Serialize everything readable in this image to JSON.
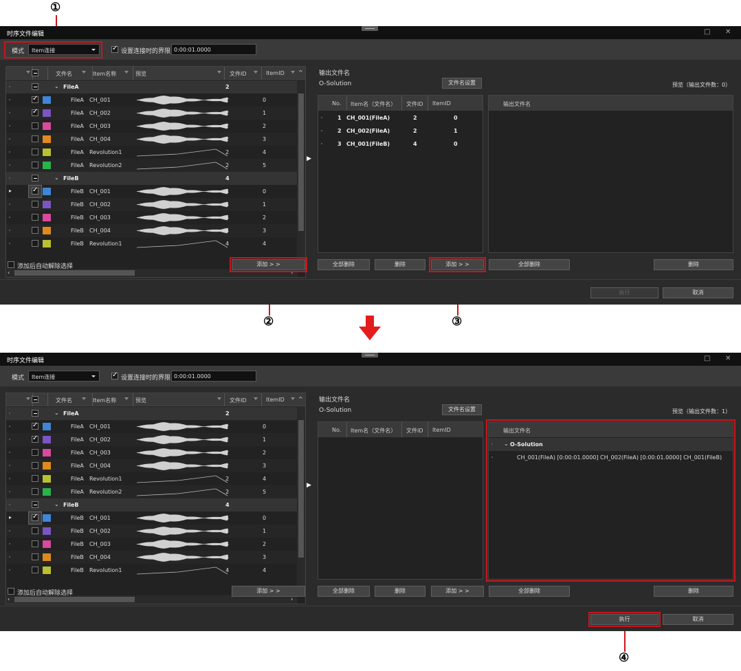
{
  "callouts": [
    "①",
    "②",
    "③",
    "④"
  ],
  "windows": [
    {
      "title": "时序文件编辑",
      "mode_label": "模式",
      "mode_value": "Item连接",
      "boundary_checked": true,
      "boundary_label": "设置连接时的界限",
      "boundary_time": "0:00:01.0000",
      "columns": {
        "filename": "文件名",
        "item_name": "Item名称",
        "preview": "预览",
        "file_id": "文件ID",
        "item_id": "ItemID"
      },
      "groups": [
        {
          "label": "FileA",
          "file_id": "2",
          "rows": [
            {
              "file": "FileA",
              "item": "CH_001",
              "fid": "2",
              "iid": "0",
              "checked": true,
              "color": "#3f86d6",
              "wave": "audio"
            },
            {
              "file": "FileA",
              "item": "CH_002",
              "fid": "2",
              "iid": "1",
              "checked": true,
              "color": "#7b55c4",
              "wave": "audio"
            },
            {
              "file": "FileA",
              "item": "CH_003",
              "fid": "2",
              "iid": "2",
              "checked": false,
              "color": "#d94a9f",
              "wave": "audio"
            },
            {
              "file": "FileA",
              "item": "CH_004",
              "fid": "2",
              "iid": "3",
              "checked": false,
              "color": "#e08a1e",
              "wave": "audio"
            },
            {
              "file": "FileA",
              "item": "Revolution1",
              "fid": "2",
              "iid": "4",
              "checked": false,
              "color": "#b9c131",
              "wave": "line"
            },
            {
              "file": "FileA",
              "item": "Revolution2",
              "fid": "2",
              "iid": "5",
              "checked": false,
              "color": "#2bb24c",
              "wave": "line"
            }
          ]
        },
        {
          "label": "FileB",
          "file_id": "4",
          "rows": [
            {
              "file": "FileB",
              "item": "CH_001",
              "fid": "4",
              "iid": "0",
              "checked": true,
              "color": "#3f86d6",
              "wave": "audio"
            },
            {
              "file": "FileB",
              "item": "CH_002",
              "fid": "4",
              "iid": "1",
              "checked": false,
              "color": "#7b55c4",
              "wave": "audio"
            },
            {
              "file": "FileB",
              "item": "CH_003",
              "fid": "4",
              "iid": "2",
              "checked": false,
              "color": "#d94a9f",
              "wave": "audio"
            },
            {
              "file": "FileB",
              "item": "CH_004",
              "fid": "4",
              "iid": "3",
              "checked": false,
              "color": "#e08a1e",
              "wave": "audio"
            },
            {
              "file": "FileB",
              "item": "Revolution1",
              "fid": "4",
              "iid": "4",
              "checked": false,
              "color": "#b9c131",
              "wave": "line"
            }
          ]
        }
      ],
      "auto_deselect_label": "添加后自动解除选择",
      "add_button": "添加 > >",
      "output_name_label": "输出文件名",
      "output_name": "O-Solution",
      "filename_settings": "文件名设置",
      "preview_count": "预览（输出文件数：0）",
      "mid_columns": {
        "no": "No.",
        "item_name": "Item名（文件名）",
        "file_id": "文件ID",
        "item_id": "ItemID"
      },
      "mid_rows": [
        {
          "no": "1",
          "item": "CH_001(FileA)",
          "fid": "2",
          "iid": "0"
        },
        {
          "no": "2",
          "item": "CH_002(FileA)",
          "fid": "2",
          "iid": "1"
        },
        {
          "no": "3",
          "item": "CH_001(FileB)",
          "fid": "4",
          "iid": "0"
        }
      ],
      "output_col": "输出文件名",
      "output_tree": null,
      "clear_all": "全部删除",
      "delete": "删除",
      "add2": "添加 > >",
      "clear_all2": "全部删除",
      "delete2": "删除",
      "execute": "执行",
      "cancel": "取消"
    },
    {
      "title": "时序文件编辑",
      "mode_label": "模式",
      "mode_value": "Item连接",
      "boundary_checked": true,
      "boundary_label": "设置连接时的界限",
      "boundary_time": "0:00:01.0000",
      "columns": {
        "filename": "文件名",
        "item_name": "Item名称",
        "preview": "预览",
        "file_id": "文件ID",
        "item_id": "ItemID"
      },
      "groups": [
        {
          "label": "FileA",
          "file_id": "2",
          "rows": [
            {
              "file": "FileA",
              "item": "CH_001",
              "fid": "2",
              "iid": "0",
              "checked": true,
              "color": "#3f86d6",
              "wave": "audio"
            },
            {
              "file": "FileA",
              "item": "CH_002",
              "fid": "2",
              "iid": "1",
              "checked": true,
              "color": "#7b55c4",
              "wave": "audio"
            },
            {
              "file": "FileA",
              "item": "CH_003",
              "fid": "2",
              "iid": "2",
              "checked": false,
              "color": "#d94a9f",
              "wave": "audio"
            },
            {
              "file": "FileA",
              "item": "CH_004",
              "fid": "2",
              "iid": "3",
              "checked": false,
              "color": "#e08a1e",
              "wave": "audio"
            },
            {
              "file": "FileA",
              "item": "Revolution1",
              "fid": "2",
              "iid": "4",
              "checked": false,
              "color": "#b9c131",
              "wave": "line"
            },
            {
              "file": "FileA",
              "item": "Revolution2",
              "fid": "2",
              "iid": "5",
              "checked": false,
              "color": "#2bb24c",
              "wave": "line"
            }
          ]
        },
        {
          "label": "FileB",
          "file_id": "4",
          "rows": [
            {
              "file": "FileB",
              "item": "CH_001",
              "fid": "4",
              "iid": "0",
              "checked": true,
              "color": "#3f86d6",
              "wave": "audio"
            },
            {
              "file": "FileB",
              "item": "CH_002",
              "fid": "4",
              "iid": "1",
              "checked": false,
              "color": "#7b55c4",
              "wave": "audio"
            },
            {
              "file": "FileB",
              "item": "CH_003",
              "fid": "4",
              "iid": "2",
              "checked": false,
              "color": "#d94a9f",
              "wave": "audio"
            },
            {
              "file": "FileB",
              "item": "CH_004",
              "fid": "4",
              "iid": "3",
              "checked": false,
              "color": "#e08a1e",
              "wave": "audio"
            },
            {
              "file": "FileB",
              "item": "Revolution1",
              "fid": "4",
              "iid": "4",
              "checked": false,
              "color": "#b9c131",
              "wave": "line"
            }
          ]
        }
      ],
      "auto_deselect_label": "添加后自动解除选择",
      "add_button": "添加 > >",
      "output_name_label": "输出文件名",
      "output_name": "O-Solution",
      "filename_settings": "文件名设置",
      "preview_count": "预览（输出文件数：1）",
      "mid_columns": {
        "no": "No.",
        "item_name": "Item名（文件名）",
        "file_id": "文件ID",
        "item_id": "ItemID"
      },
      "mid_rows": [],
      "output_col": "输出文件名",
      "output_tree": {
        "label": "O-Solution",
        "child": "CH_001(FileA) [0:00:01.0000] CH_002(FileA) [0:00:01.0000] CH_001(FileB)"
      },
      "clear_all": "全部删除",
      "delete": "删除",
      "add2": "添加 > >",
      "clear_all2": "全部删除",
      "delete2": "删除",
      "execute": "执行",
      "cancel": "取消"
    }
  ]
}
